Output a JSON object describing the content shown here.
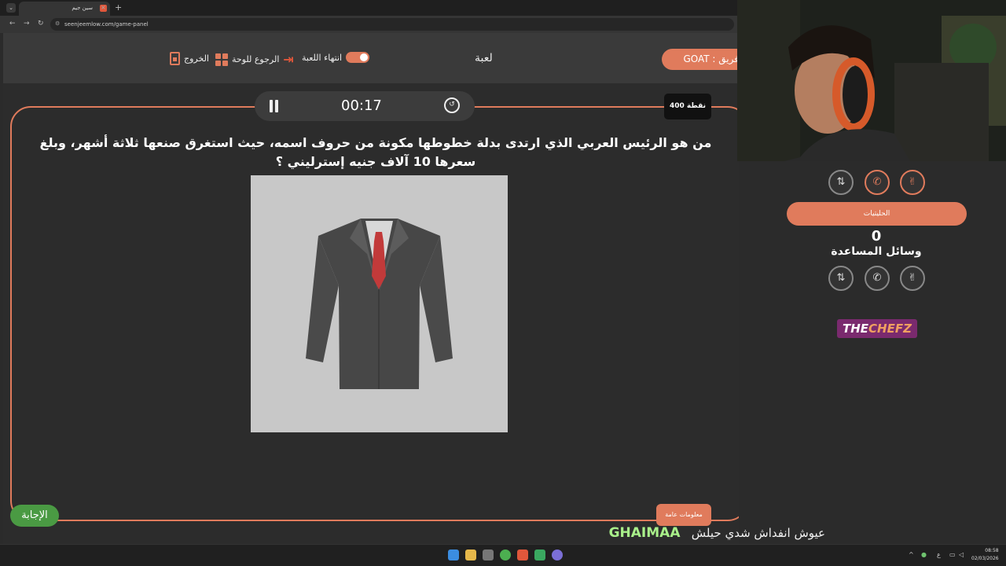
{
  "browser": {
    "tab_title": "سين جيم",
    "tab_close": "×",
    "new_tab": "+",
    "url": "seenjeemlow.com/game-panel"
  },
  "header": {
    "team_label": "فريق : GOAT",
    "game_title": "لعبة",
    "end_game_label": "انتهاء اللعبة",
    "back_to_board_label": "الرجوع للوحة",
    "exit_label": "الخروج"
  },
  "timer": {
    "time": "00:17"
  },
  "question": {
    "points": "400 نقطة",
    "text": "من هو الرئيس العربي الذي ارتدى بدلة خطوطها مكونة من حروف اسمه، حيث استغرق صنعها ثلاثة أشهر، وبلغ سعرها 10 آلاف جنيه إسترليني ؟",
    "info_label": "معلومات عامة",
    "answer_label": "الإجابة"
  },
  "right_panel": {
    "hawks_label": "الحليتيات",
    "score": "0",
    "aids_label": "وسائل المساعدة"
  },
  "sponsor": {
    "part1": "THE",
    "part2": "CHEFZ"
  },
  "chat": {
    "user": "GHAIMAA",
    "message": "عيوش انفداش شدي حيلش"
  },
  "taskbar": {
    "time": "08:58",
    "date": "02/03/2026",
    "lang": "ع"
  },
  "colors": {
    "accent": "#e07b5c",
    "answer_green": "#4a9a43",
    "background": "#2b2b2b"
  }
}
